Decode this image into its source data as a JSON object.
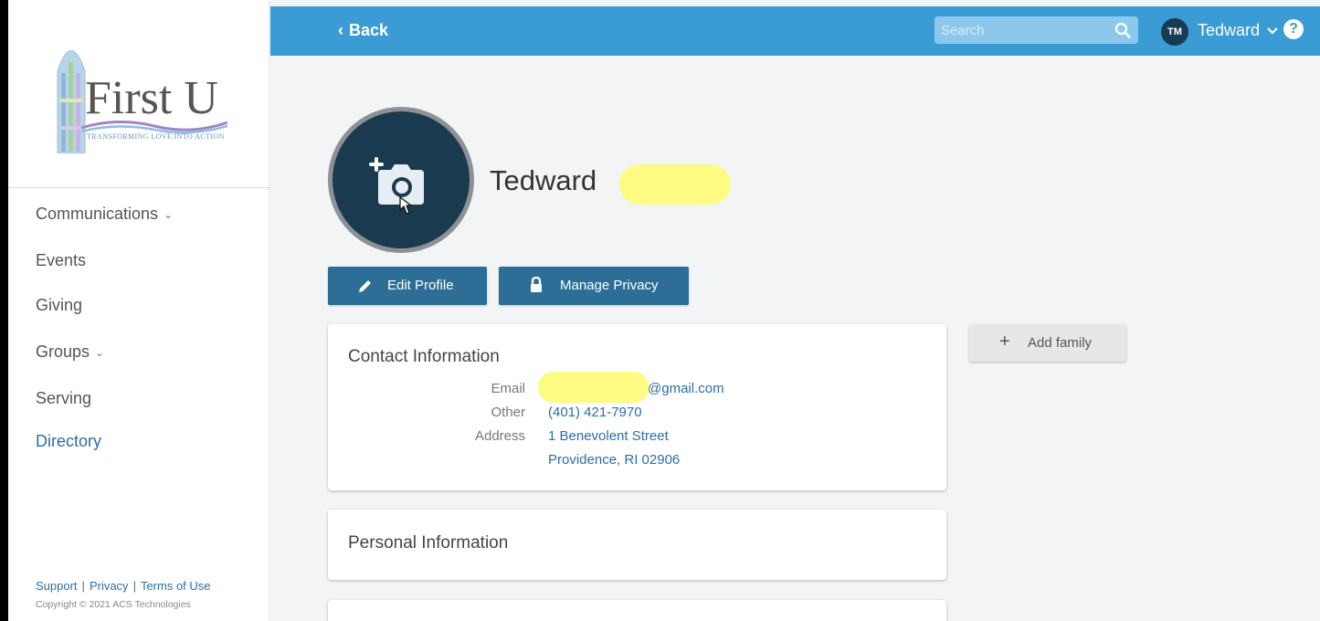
{
  "app": {
    "logo_title": "First U",
    "logo_tagline": "Transforming Love Into Action"
  },
  "sidebar": {
    "items": [
      {
        "label": "Communications",
        "has_chevron": true
      },
      {
        "label": "Events",
        "has_chevron": false
      },
      {
        "label": "Giving",
        "has_chevron": false
      },
      {
        "label": "Groups",
        "has_chevron": true
      },
      {
        "label": "Serving",
        "has_chevron": false
      },
      {
        "label": "Directory",
        "has_chevron": false,
        "active": true
      }
    ],
    "footer": {
      "support": "Support",
      "privacy": "Privacy",
      "terms": "Terms of Use",
      "separator": "|",
      "copyright": "Copyright © 2021 ACS Technologies"
    }
  },
  "header": {
    "back_label": "Back",
    "search_placeholder": "Search",
    "user_initials": "TM",
    "user_name": "Tedward",
    "help_label": "?"
  },
  "profile": {
    "name": "Tedward",
    "edit_button": "Edit Profile",
    "privacy_button": "Manage Privacy",
    "add_family": "Add family"
  },
  "contact": {
    "title": "Contact Information",
    "email_label": "Email",
    "email_value": "@gmail.com",
    "other_label": "Other",
    "other_value": "(401) 421-7970",
    "address_label": "Address",
    "address_line1": "1 Benevolent Street",
    "address_line2": "Providence, RI 02906"
  },
  "personal": {
    "title": "Personal Information"
  },
  "colors": {
    "topbar": "#3a9bd5",
    "button": "#2d6e96",
    "link": "#2a6fa8",
    "avatar": "#1a3b4f",
    "redaction": "#fdfb82"
  }
}
